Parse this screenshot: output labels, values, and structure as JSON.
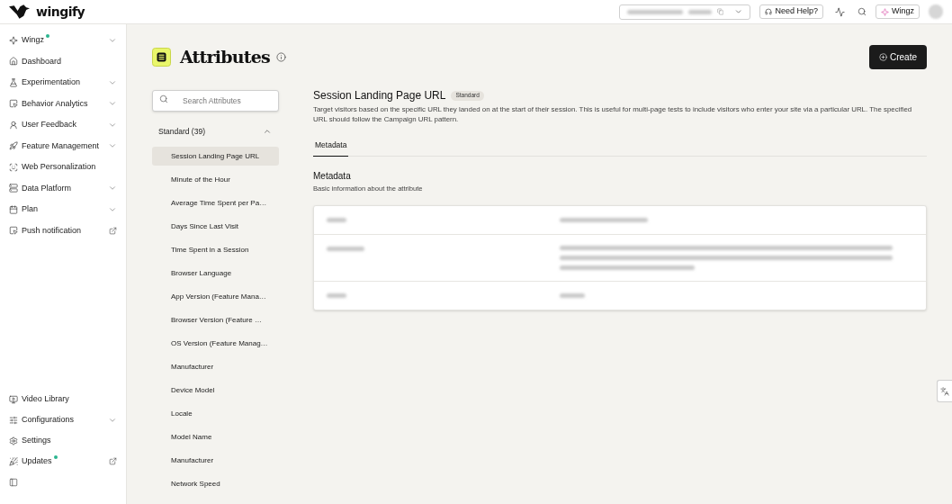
{
  "topbar": {
    "logo": "wingify",
    "help_button": "Need Help?",
    "wingz_button": "Wingz"
  },
  "sidebar": {
    "items": [
      {
        "label": "Wingz",
        "kind": "group",
        "new": true
      },
      {
        "label": "Dashboard",
        "kind": "page",
        "new": false
      },
      {
        "label": "Experimentation",
        "kind": "group",
        "new": false
      },
      {
        "label": "Behavior Analytics",
        "kind": "group",
        "new": false
      },
      {
        "label": "User Feedback",
        "kind": "group",
        "new": false
      },
      {
        "label": "Feature Management",
        "kind": "group",
        "new": false
      },
      {
        "label": "Web Personalization",
        "kind": "page",
        "new": false
      },
      {
        "label": "Data Platform",
        "kind": "group",
        "new": false
      },
      {
        "label": "Plan",
        "kind": "group",
        "new": false
      },
      {
        "label": "Push notification",
        "kind": "external",
        "new": false
      }
    ],
    "bottom_items": [
      {
        "label": "Video Library",
        "kind": "page",
        "new": false
      },
      {
        "label": "Configurations",
        "kind": "group",
        "new": false
      },
      {
        "label": "Settings",
        "kind": "page",
        "new": false
      },
      {
        "label": "Updates",
        "kind": "external",
        "new": true
      }
    ]
  },
  "page": {
    "title": "Attributes",
    "create_button": "Create"
  },
  "attributes": {
    "search": {
      "placeholder": "Search Attributes"
    },
    "group": {
      "label": "Standard (39)",
      "expanded": true
    },
    "items": [
      {
        "label": "Session Landing Page URL",
        "selected": true
      },
      {
        "label": "Minute of the Hour",
        "selected": false
      },
      {
        "label": "Average Time Spent per Pa…",
        "selected": false
      },
      {
        "label": "Days Since Last Visit",
        "selected": false
      },
      {
        "label": "Time Spent in a Session",
        "selected": false
      },
      {
        "label": "Browser Language",
        "selected": false
      },
      {
        "label": "App Version (Feature Mana…",
        "selected": false
      },
      {
        "label": "Browser Version (Feature …",
        "selected": false
      },
      {
        "label": "OS Version (Feature Manag…",
        "selected": false
      },
      {
        "label": "Manufacturer",
        "selected": false
      },
      {
        "label": "Device Model",
        "selected": false
      },
      {
        "label": "Locale",
        "selected": false
      },
      {
        "label": "Model Name",
        "selected": false
      },
      {
        "label": "Manufacturer",
        "selected": false
      },
      {
        "label": "Network Speed",
        "selected": false
      }
    ]
  },
  "detail": {
    "title": "Session Landing Page URL",
    "badge": "Standard",
    "description": "Target visitors based on the specific URL they landed on at the start of their session. This is useful for multi-page tests to include visitors who enter your site via a particular URL. The specified URL should follow the Campaign URL pattern.",
    "tabs": [
      {
        "label": "Metadata",
        "selected": true
      }
    ],
    "section": {
      "title": "Metadata",
      "subtitle": "Basic information about the attribute"
    },
    "metadata_table": {
      "rows": [
        {
          "kind": "short"
        },
        {
          "kind": "long"
        },
        {
          "kind": "short"
        }
      ]
    }
  }
}
